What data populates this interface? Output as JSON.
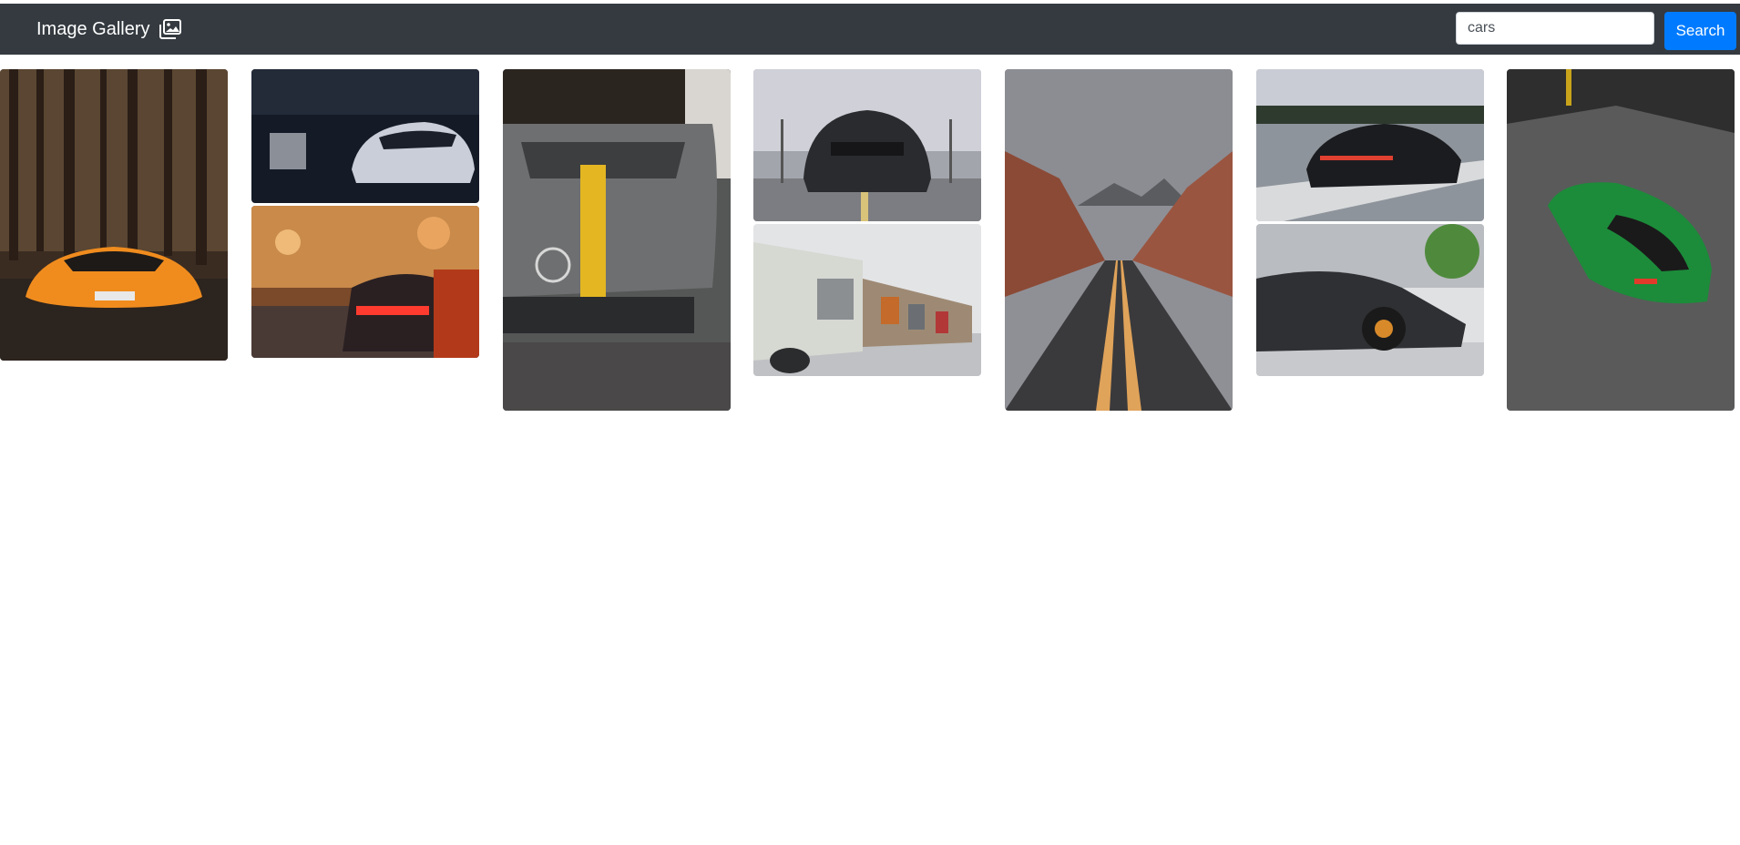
{
  "navbar": {
    "brand": "Image Gallery",
    "brand_icon": "images-icon",
    "search": {
      "value": "cars",
      "placeholder": ""
    },
    "search_button": "Search",
    "colors": {
      "navbar_bg": "#343a40",
      "button_bg": "#007bff"
    }
  },
  "gallery": {
    "columns": 7,
    "photos": [
      {
        "id": "orange-lamborghini-forest",
        "description": "orange supercar in dark forest"
      },
      {
        "id": "white-camaro-garage",
        "description": "white sports car in dark garage"
      },
      {
        "id": "red-audi-taillights",
        "description": "red tail lights on city street"
      },
      {
        "id": "grey-mercedes-yellow-stripe",
        "description": "grey mercedes with yellow stripe"
      },
      {
        "id": "black-mustang-parking",
        "description": "black mustang front view"
      },
      {
        "id": "vintage-bmw-row",
        "description": "row of vintage cars in showroom"
      },
      {
        "id": "desert-road-canyon",
        "description": "empty road through red canyon"
      },
      {
        "id": "black-porsche-highway",
        "description": "black porsche on highway"
      },
      {
        "id": "black-lamborghini-side",
        "description": "black lamborghini side view"
      },
      {
        "id": "green-mustang-top",
        "description": "green mustang from above"
      }
    ]
  }
}
